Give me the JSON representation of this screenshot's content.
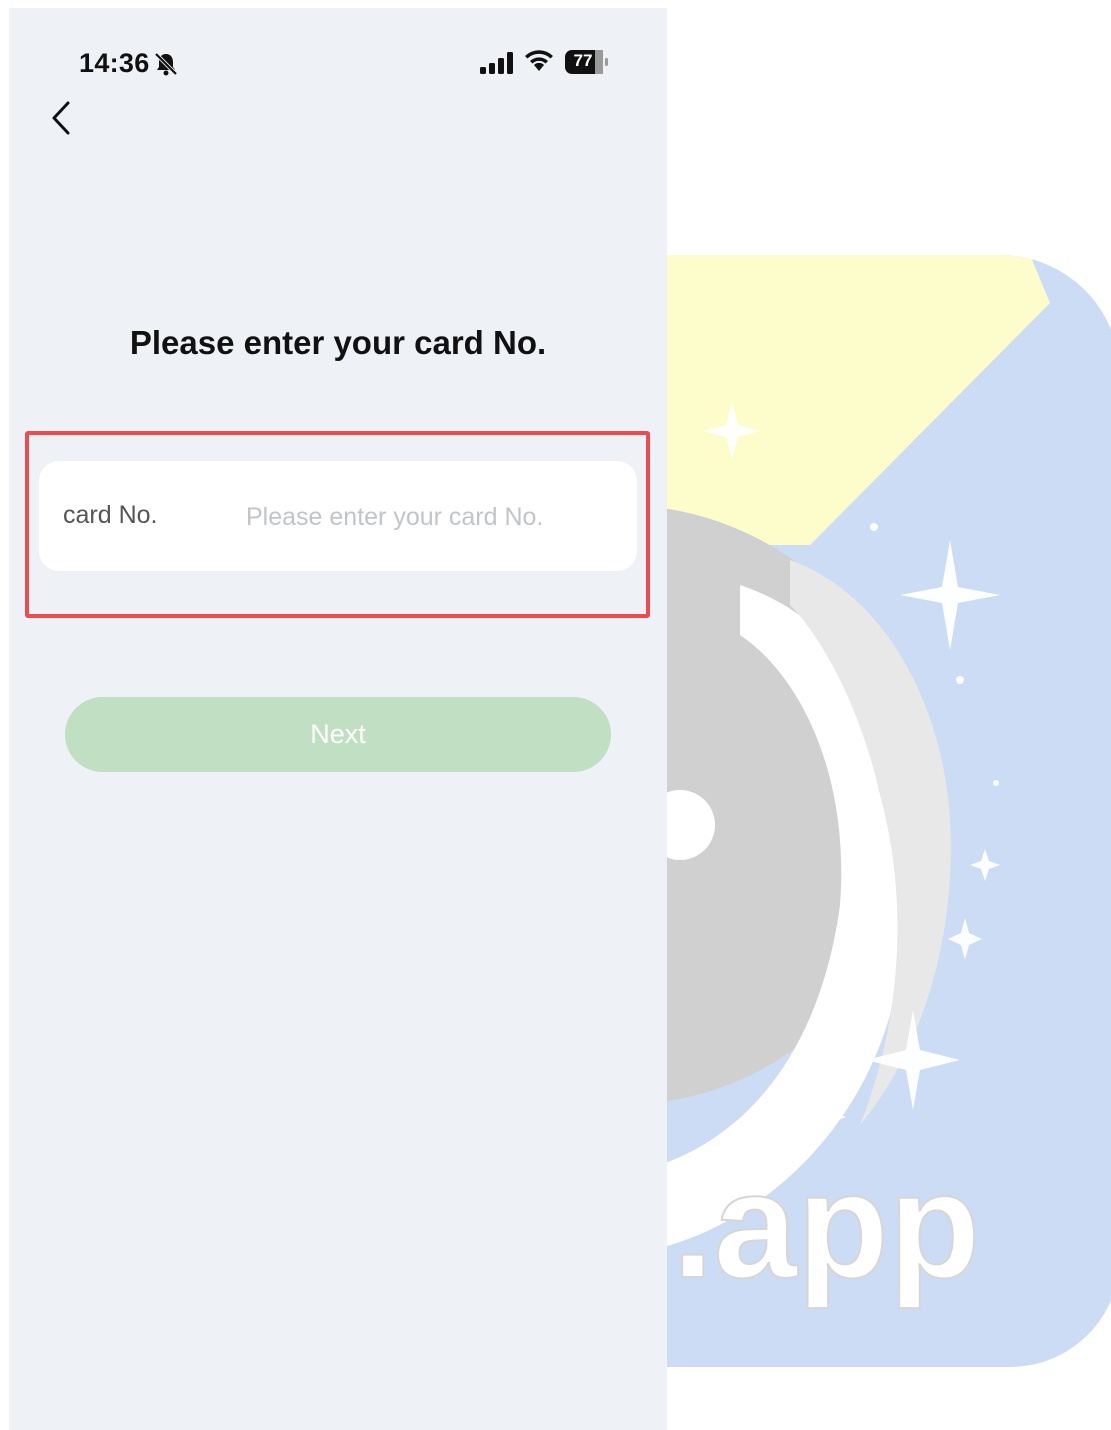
{
  "status_bar": {
    "time": "14:36",
    "battery_level": "77",
    "icons": [
      "bell-slash-icon",
      "signal-icon",
      "wifi-icon",
      "battery-icon"
    ]
  },
  "nav": {
    "back_icon": "chevron-left-icon"
  },
  "page": {
    "title": "Please enter your card No."
  },
  "form": {
    "card_label": "card No.",
    "card_value": "",
    "card_placeholder": "Please enter your card No."
  },
  "actions": {
    "next_label": "Next"
  },
  "watermark": {
    "text": ".app"
  },
  "colors": {
    "background": "#eef1f6",
    "highlight": "#ee4b51",
    "next_button": "#c1dfc2",
    "logo_yellow": "#fdfdcc",
    "logo_blue": "#ccdcf5"
  }
}
